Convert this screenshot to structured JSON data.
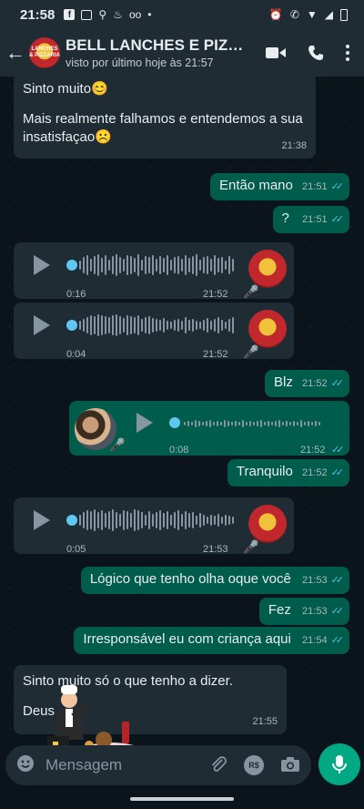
{
  "status_bar": {
    "time": "21:58",
    "left_icons": [
      "facebook-icon",
      "message-icon",
      "search-icon",
      "bell-icon",
      "voicemail-icon",
      "dot-icon"
    ],
    "right_icons": [
      "alarm-icon",
      "call-wifi-icon",
      "wifi-icon",
      "signal-icon",
      "battery-icon"
    ]
  },
  "header": {
    "title": "BELL LANCHES E PIZZ...",
    "subtitle": "visto por último hoje às 21:57",
    "avatar_text": "LANCHES & PIZZARIA"
  },
  "messages": [
    {
      "dir": "in",
      "type": "text",
      "text": "Sinto muito😊",
      "text2": "Mais realmente falhamos e entendemos a sua insatisfaçao☹️",
      "time": "21:38"
    },
    {
      "dir": "out",
      "type": "text",
      "text": "Então mano",
      "time": "21:51"
    },
    {
      "dir": "out",
      "type": "text",
      "text": "?",
      "time": "21:51"
    },
    {
      "dir": "in",
      "type": "audio",
      "duration": "0:16",
      "time": "21:52"
    },
    {
      "dir": "in",
      "type": "audio",
      "duration": "0:04",
      "time": "21:52"
    },
    {
      "dir": "out",
      "type": "text",
      "text": "Blz",
      "time": "21:52"
    },
    {
      "dir": "out",
      "type": "audio",
      "duration": "0:08",
      "time": "21:52"
    },
    {
      "dir": "out",
      "type": "text",
      "text": "Tranquilo",
      "time": "21:52"
    },
    {
      "dir": "in",
      "type": "audio",
      "duration": "0:05",
      "time": "21:53"
    },
    {
      "dir": "out",
      "type": "text",
      "text": "Lógico que tenho olha oque você",
      "time": "21:53"
    },
    {
      "dir": "out",
      "type": "text",
      "text": "Fez",
      "time": "21:53"
    },
    {
      "dir": "out",
      "type": "text",
      "text": "Irresponsável eu com criança aqui",
      "time": "21:54"
    },
    {
      "dir": "in",
      "type": "text",
      "text": "Sinto muito só o que tenho a dizer.",
      "text2": "Deus",
      "time": "21:55"
    }
  ],
  "composer": {
    "placeholder": "Mensagem",
    "tools": [
      "emoji-icon",
      "attach-icon",
      "pix-icon",
      "camera-icon"
    ],
    "pix_label": "R$"
  },
  "colors": {
    "incoming": "#1f2c34",
    "outgoing": "#005c4b",
    "accent": "#00a884",
    "ticks": "#53bdeb"
  }
}
